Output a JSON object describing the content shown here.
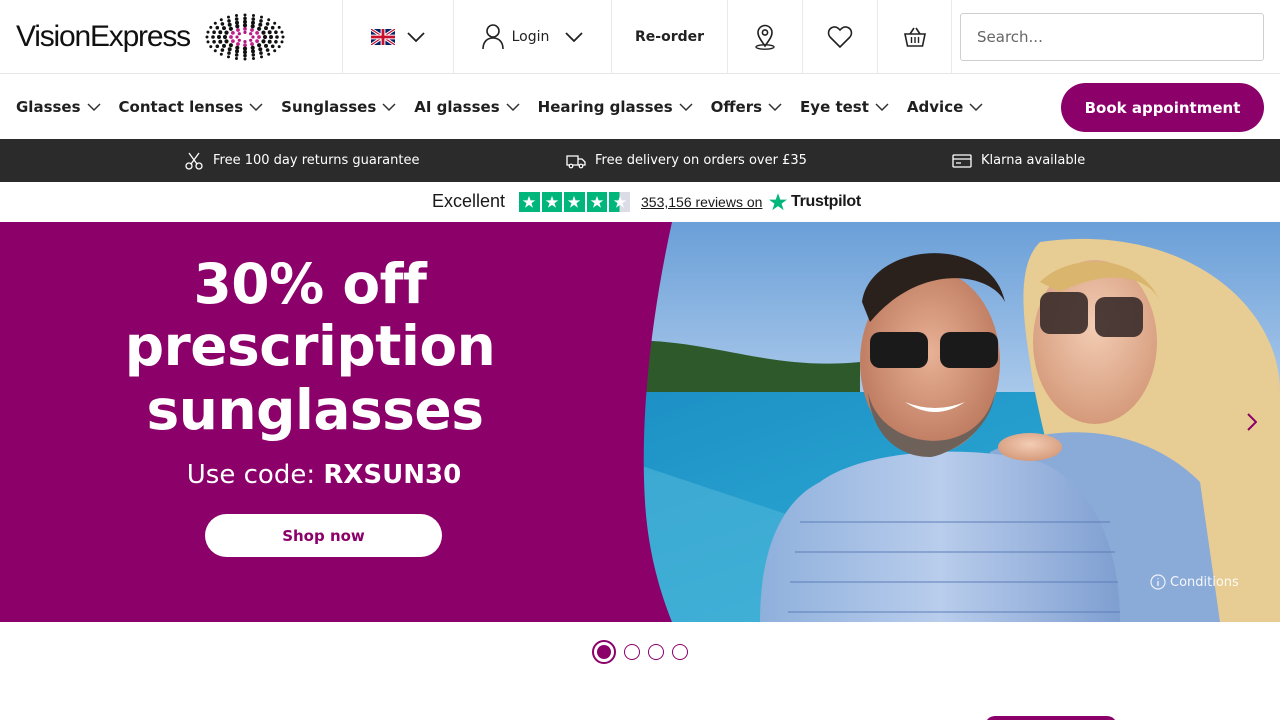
{
  "header": {
    "logo_text": "VisionExpress",
    "country_flag": "uk-flag-icon",
    "login_label": "Login",
    "reorder_label": "Re-order",
    "icons": [
      "user-icon",
      "store-locator-icon",
      "heart-icon",
      "basket-icon"
    ],
    "search_placeholder": "Search..."
  },
  "nav": {
    "items": [
      {
        "label": "Glasses"
      },
      {
        "label": "Contact lenses"
      },
      {
        "label": "Sunglasses"
      },
      {
        "label": "AI glasses"
      },
      {
        "label": "Hearing glasses"
      },
      {
        "label": "Offers"
      },
      {
        "label": "Eye test"
      },
      {
        "label": "Advice"
      }
    ],
    "book_label": "Book appointment"
  },
  "usp": [
    {
      "icon": "returns-icon",
      "text": "Free 100 day returns guarantee"
    },
    {
      "icon": "delivery-truck-icon",
      "text": "Free delivery on orders over £35"
    },
    {
      "icon": "card-icon",
      "text": "Klarna available"
    }
  ],
  "trustpilot": {
    "rating_word": "Excellent",
    "stars": 4.5,
    "reviews_text": "353,156 reviews on",
    "brand": "Trustpilot"
  },
  "hero": {
    "line1": "30% off",
    "line2": "prescription",
    "line3": "sunglasses",
    "code_prefix": "Use code: ",
    "code": "RXSUN30",
    "cta_label": "Shop now",
    "conditions_label": "Conditions",
    "slide_count": 4,
    "active_slide": 1
  },
  "colors": {
    "brand_purple": "#8b0069",
    "usp_bar": "#2b2b2b",
    "trustpilot_green": "#00b67a"
  }
}
